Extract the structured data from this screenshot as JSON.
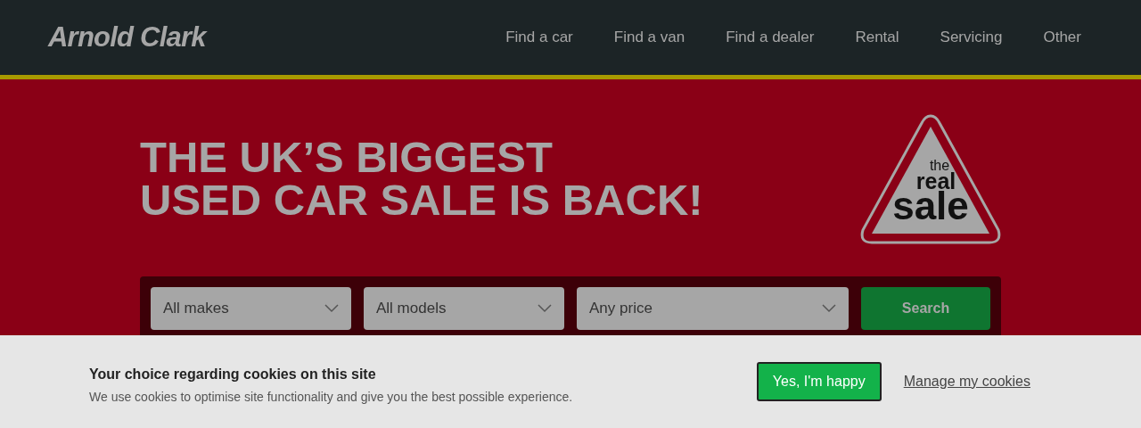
{
  "header": {
    "logo": "Arnold Clark",
    "nav": [
      {
        "label": "Find a car"
      },
      {
        "label": "Find a van"
      },
      {
        "label": "Find a dealer"
      },
      {
        "label": "Rental"
      },
      {
        "label": "Servicing"
      },
      {
        "label": "Other"
      }
    ]
  },
  "hero": {
    "headline": [
      "THE UK’S BIGGEST",
      "USED CAR SALE IS BACK!"
    ],
    "badge": [
      "the",
      "real",
      "sale"
    ]
  },
  "search": {
    "selects": [
      {
        "value": "All makes"
      },
      {
        "value": "All models"
      },
      {
        "value": "Any price"
      }
    ],
    "button": "Search"
  },
  "cookie_banner": {
    "title": "Your choice regarding cookies on this site",
    "text": "We use cookies to optimise site functionality and give you the best possible experience.",
    "accept": "Yes, I'm happy",
    "manage": "Manage my cookies"
  }
}
